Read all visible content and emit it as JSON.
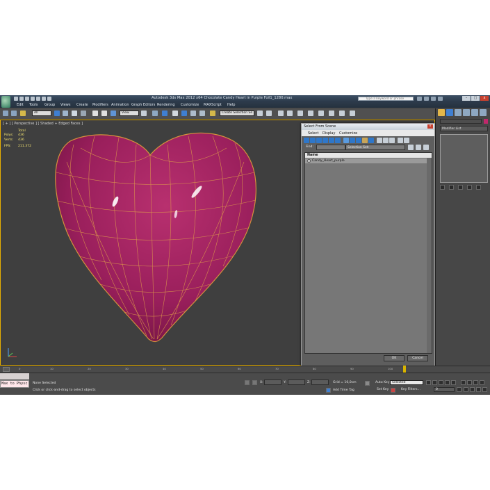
{
  "window": {
    "title": "Autodesk 3ds Max  2012 x64      Chocolate Candy Heart in Purple Foil1_1280.max",
    "help_search_placeholder": "Type a keyword or phrase",
    "btn_minimize": "–",
    "btn_maximize": "□",
    "btn_close": "x"
  },
  "menu": [
    "Edit",
    "Tools",
    "Group",
    "Views",
    "Create",
    "Modifiers",
    "Animation",
    "Graph Editors",
    "Rendering",
    "Customize",
    "MAXScript",
    "Help"
  ],
  "toolbar": {
    "filter_value": "All",
    "reference_coord": "View",
    "named_selection": "Create Selection Se"
  },
  "viewport": {
    "label": "[ + ] [ Perspective ] [ Shaded + Edged Faces ]",
    "stats": {
      "total_label": "Total",
      "polys_label": "Polys:",
      "polys_value": "436",
      "verts_label": "Verts:",
      "verts_value": "436",
      "fps_label": "FPS:",
      "fps_value": "211.372"
    }
  },
  "dialog": {
    "title": "Select From Scene",
    "close": "x",
    "menu": [
      "Select",
      "Display",
      "Customize"
    ],
    "find_label": "Find:",
    "selection_set_label": "Selection Set:",
    "column_name": "Name",
    "objects": [
      "Candy_Heart_purple"
    ],
    "ok_label": "OK",
    "cancel_label": "Cancel"
  },
  "command_panel": {
    "modifier_list": "Modifier List"
  },
  "timeline": {
    "frames": [
      "0",
      "10",
      "20",
      "30",
      "40",
      "50",
      "60",
      "70",
      "80",
      "90",
      "100"
    ]
  },
  "status": {
    "listener_text": "Max to Physc",
    "selection_status": "None Selected",
    "prompt": "Click or click-and-drag to select objects",
    "x_label": "X:",
    "y_label": "Y:",
    "z_label": "Z:",
    "grid": "Grid = 10,0cm",
    "add_time_tag": "Add Time Tag",
    "auto_key": "Auto Key",
    "auto_key_value": "Selected",
    "set_key": "Set Key",
    "key_filters": "Key Filters...",
    "current_frame": "0"
  },
  "colors": {
    "heart_fill": "#a22363",
    "wire": "#e0a14a",
    "viewport_border": "#e8b000",
    "object_color_swatch": "#c0286b"
  }
}
